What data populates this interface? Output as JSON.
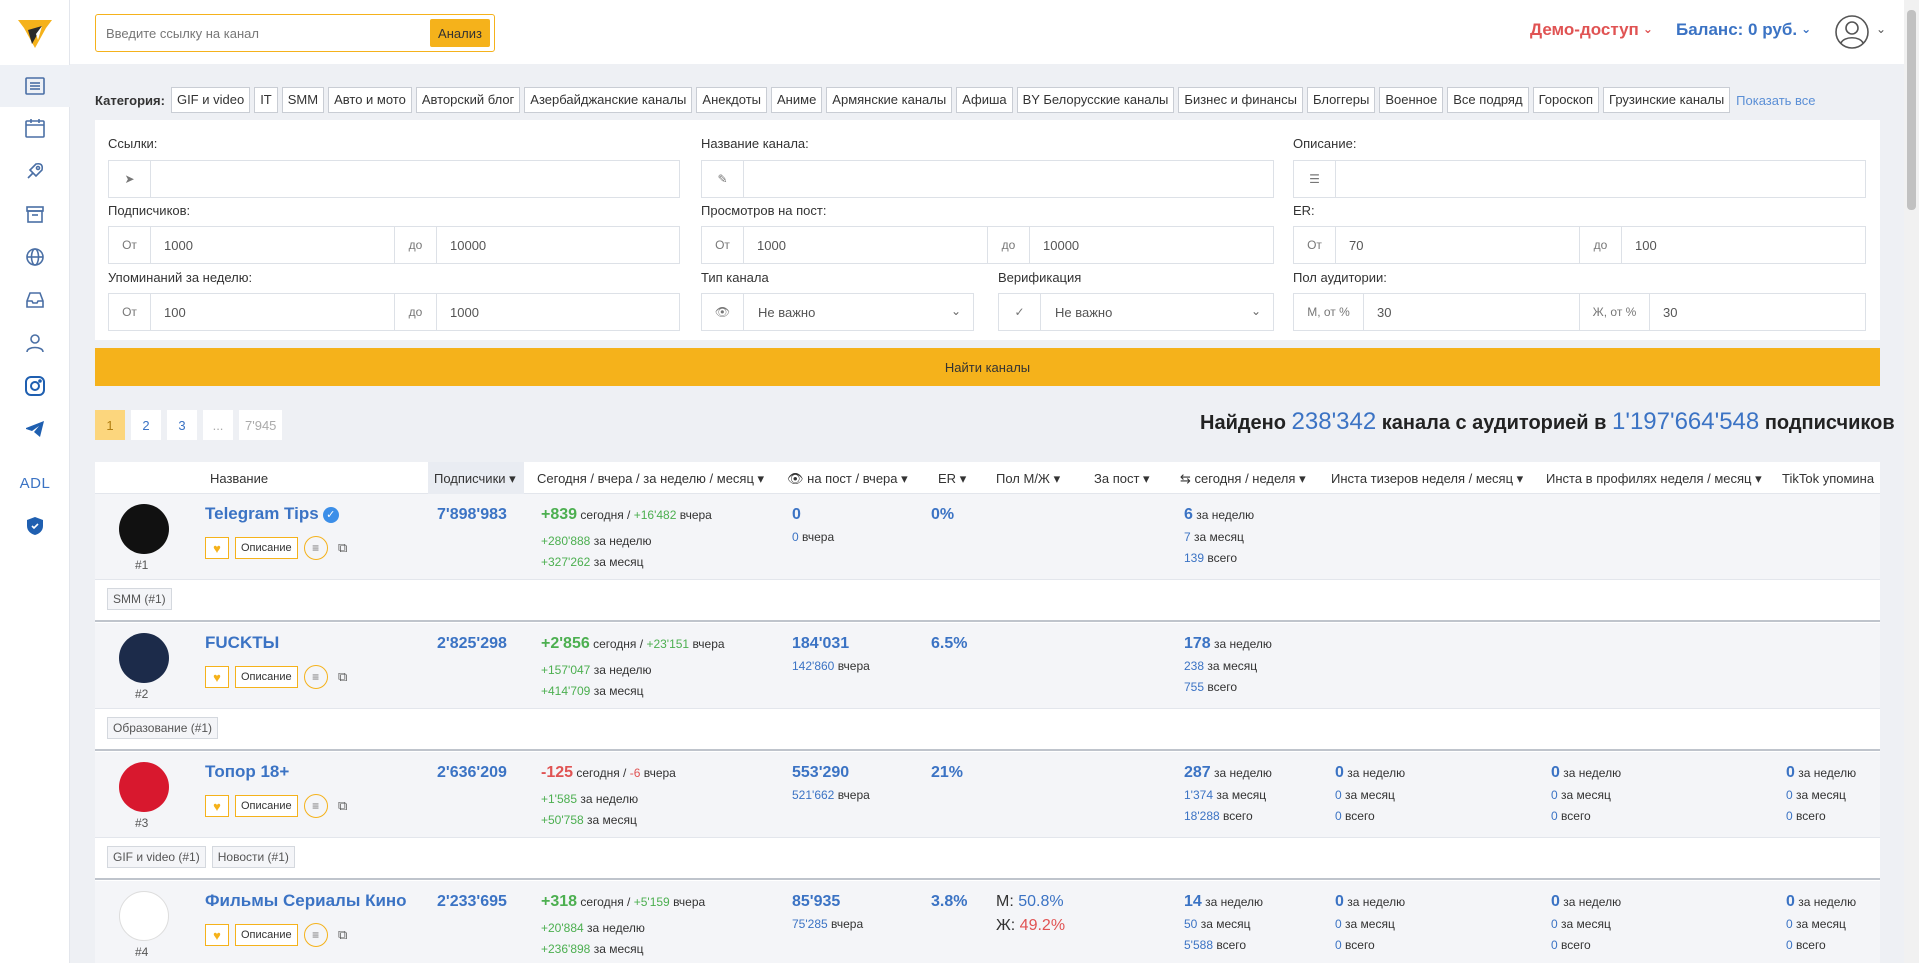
{
  "header": {
    "search_placeholder": "Введите ссылку на канал",
    "analyze_label": "Анализ",
    "demo_label": "Демо-доступ",
    "balance_label": "Баланс: 0 руб."
  },
  "sidebar": {
    "items": [
      {
        "icon": "list-icon"
      },
      {
        "icon": "calendar-icon"
      },
      {
        "icon": "rocket-icon"
      },
      {
        "icon": "archive-icon"
      },
      {
        "icon": "globe-icon"
      },
      {
        "icon": "inbox-icon"
      },
      {
        "icon": "users-icon"
      },
      {
        "icon": "instagram-icon"
      },
      {
        "icon": "telegram-icon"
      },
      {
        "icon": "adl-text",
        "label": "ADL"
      },
      {
        "icon": "shield-icon"
      }
    ]
  },
  "categories": {
    "label": "Категория:",
    "tags": [
      "GIF и video",
      "IT",
      "SMM",
      "Авто и мото",
      "Авторский блог",
      "Азербайджанские каналы",
      "Анекдоты",
      "Аниме",
      "Армянские каналы",
      "Афиша",
      "BY Белорусские каналы",
      "Бизнес и финансы",
      "Блоггеры",
      "Военное",
      "Все подряд",
      "Гороскоп",
      "Грузинские каналы"
    ],
    "show_all": "Показать все"
  },
  "filters": {
    "links_label": "Ссылки:",
    "name_label": "Название канала:",
    "desc_label": "Описание:",
    "subs_label": "Подписчиков:",
    "subs_from_prefix": "От",
    "subs_from": "1000",
    "subs_to_prefix": "до",
    "subs_to": "10000",
    "views_label": "Просмотров на пост:",
    "views_from_prefix": "От",
    "views_from": "1000",
    "views_to_prefix": "до",
    "views_to": "10000",
    "er_label": "ER:",
    "er_from_prefix": "От",
    "er_from": "70",
    "er_to_prefix": "до",
    "er_to": "100",
    "mentions_label": "Упоминаний за неделю:",
    "mentions_from_prefix": "От",
    "mentions_from": "100",
    "mentions_to_prefix": "до",
    "mentions_to": "1000",
    "type_label": "Тип канала",
    "type_value": "Не важно",
    "verif_label": "Верификация",
    "verif_value": "Не важно",
    "gender_label": "Пол аудитории:",
    "gender_m_prefix": "М, от %",
    "gender_m": "30",
    "gender_f_prefix": "Ж, от %",
    "gender_f": "30",
    "find_button": "Найти каналы"
  },
  "pagination": {
    "pages": [
      "1",
      "2",
      "3",
      "...",
      "7'945"
    ],
    "active": "1"
  },
  "summary": {
    "prefix": "Найдено",
    "channels": "238'342",
    "middle": "канала с аудиторией в",
    "audience": "1'197'664'548",
    "suffix": "подписчиков"
  },
  "table": {
    "headers": {
      "name": "Название",
      "subs": "Подписчики",
      "today": "Сегодня / вчера / за неделю / месяц",
      "views": "на пост / вчера",
      "er": "ER",
      "gender": "Пол М/Ж",
      "per_post": "За пост",
      "reposts": "сегодня / неделя",
      "insta_teasers": "Инста тизеров неделя / месяц",
      "insta_profiles": "Инста в профилях неделя / месяц",
      "tiktok": "TikTok упомина"
    },
    "rows": [
      {
        "name": "Telegram Tips",
        "verified": true,
        "rank": "#1",
        "subs": "7'898'983",
        "today": "+839",
        "today_label": "сегодня /",
        "yesterday": "+16'482",
        "yesterday_label": "вчера",
        "week": "+280'888",
        "week_label": "за неделю",
        "month": "+327'262",
        "month_label": "за месяц",
        "views": "0",
        "views_y": "0",
        "views_y_label": "вчера",
        "er": "0%",
        "rep_week": "6",
        "rep_week_label": "за неделю",
        "rep_month": "7",
        "rep_month_label": "за месяц",
        "rep_total": "139",
        "rep_total_label": "всего",
        "tags": [
          "SMM (#1)"
        ],
        "desc_label": "Описание"
      },
      {
        "name": "FUCKTЫ",
        "verified": false,
        "rank": "#2",
        "subs": "2'825'298",
        "today": "+2'856",
        "today_label": "сегодня /",
        "yesterday": "+23'151",
        "yesterday_label": "вчера",
        "week": "+157'047",
        "week_label": "за неделю",
        "month": "+414'709",
        "month_label": "за месяц",
        "views": "184'031",
        "views_y": "142'860",
        "views_y_label": "вчера",
        "er": "6.5%",
        "rep_week": "178",
        "rep_week_label": "за неделю",
        "rep_month": "238",
        "rep_month_label": "за месяц",
        "rep_total": "755",
        "rep_total_label": "всего",
        "tags": [
          "Образование (#1)"
        ],
        "desc_label": "Описание"
      },
      {
        "name": "Топор 18+",
        "verified": false,
        "rank": "#3",
        "subs": "2'636'209",
        "today": "-125",
        "today_label": "сегодня /",
        "yesterday": "-6",
        "yesterday_label": "вчера",
        "week": "+1'585",
        "week_label": "за неделю",
        "month": "+50'758",
        "month_label": "за месяц",
        "views": "553'290",
        "views_y": "521'662",
        "views_y_label": "вчера",
        "er": "21%",
        "rep_week": "287",
        "rep_week_label": "за неделю",
        "rep_month": "1'374",
        "rep_month_label": "за месяц",
        "rep_total": "18'288",
        "rep_total_label": "всего",
        "insta_t": [
          "0",
          "0",
          "0"
        ],
        "insta_p": [
          "0",
          "0",
          "0"
        ],
        "tiktok": [
          "0",
          "0",
          "0"
        ],
        "tags": [
          "GIF и video (#1)",
          "Новости (#1)"
        ],
        "desc_label": "Описание"
      },
      {
        "name": "Фильмы Сериалы Кино",
        "verified": false,
        "rank": "#4",
        "subs": "2'233'695",
        "today": "+318",
        "today_label": "сегодня /",
        "yesterday": "+5'159",
        "yesterday_label": "вчера",
        "week": "+20'884",
        "week_label": "за неделю",
        "month": "+236'898",
        "month_label": "за месяц",
        "views": "85'935",
        "views_y": "75'285",
        "views_y_label": "вчера",
        "er": "3.8%",
        "gender_m_label": "М:",
        "gender_m": "50.8%",
        "gender_f_label": "Ж:",
        "gender_f": "49.2%",
        "rep_week": "14",
        "rep_week_label": "за неделю",
        "rep_month": "50",
        "rep_month_label": "за месяц",
        "rep_total": "5'588",
        "rep_total_label": "всего",
        "insta_t": [
          "0",
          "0",
          "0"
        ],
        "insta_p": [
          "0",
          "0",
          "0"
        ],
        "tiktok": [
          "0",
          "0",
          "0"
        ],
        "tags": [],
        "desc_label": "Описание"
      }
    ],
    "period_labels": [
      "за неделю",
      "за месяц",
      "всего"
    ]
  },
  "colors": {
    "accent": "#f5b21b",
    "link": "#3b73c4",
    "positive": "#4caf50",
    "negative": "#e05353"
  }
}
